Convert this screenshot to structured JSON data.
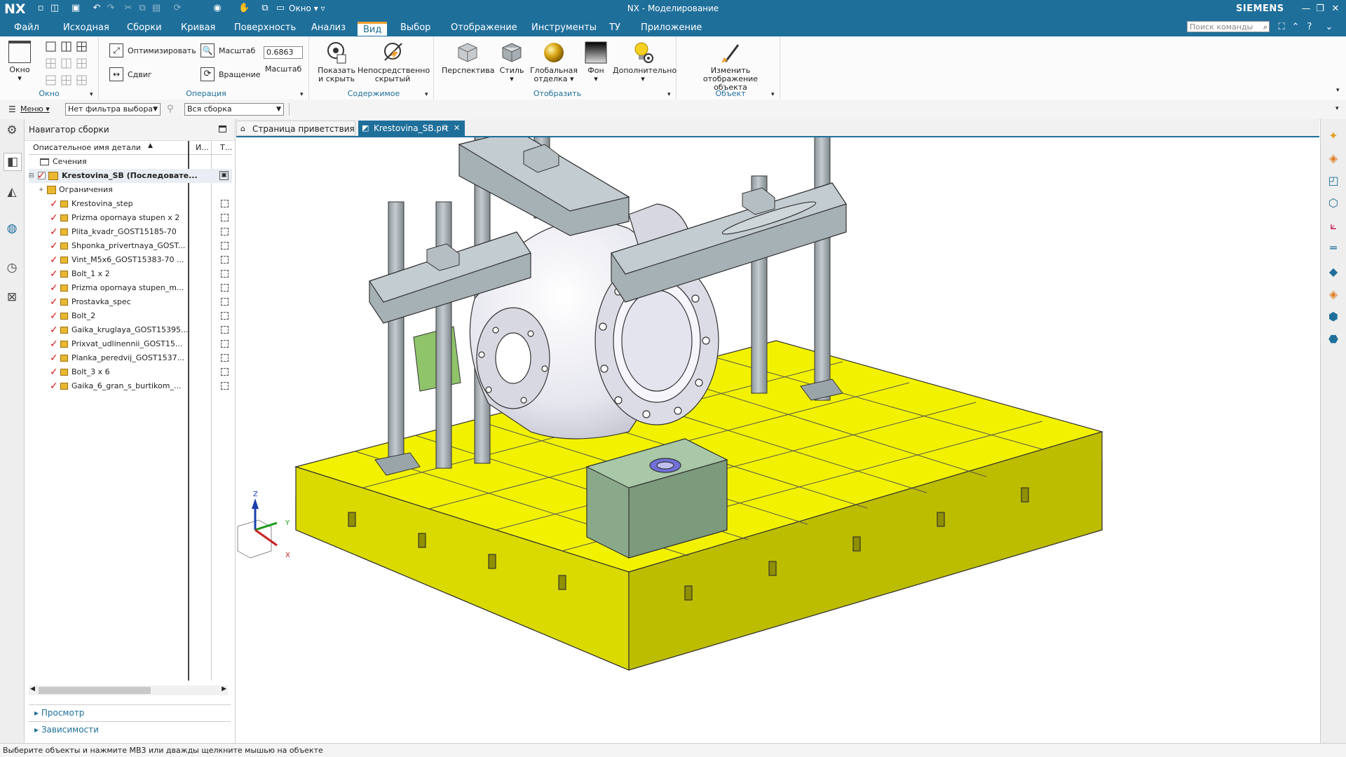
{
  "app": {
    "logo": "NX",
    "title": "NX - Моделирование",
    "brand": "SIEMENS",
    "window_menu_label": "Окно",
    "accent_color": "#1f6f9b",
    "highlight_color": "#f0a030"
  },
  "menubar": {
    "items": [
      "Файл",
      "Исходная",
      "Сборки",
      "Кривая",
      "Поверхность",
      "Анализ",
      "Вид",
      "Выбор",
      "Отображение",
      "Инструменты",
      "ТУ",
      "Приложение"
    ],
    "active_index": 6,
    "search_placeholder": "Поиск команды"
  },
  "ribbon": {
    "window_group": {
      "label": "Окно",
      "button": "Окно"
    },
    "operation_group": {
      "label": "Операция",
      "fit": "Оптимизировать",
      "pan": "Сдвиг",
      "zoom": "Масштаб",
      "rotate": "Вращение",
      "scale_value": "0.6863",
      "scale_label": "Масштаб"
    },
    "content_group": {
      "label": "Содержимое",
      "show_hide_line1": "Показать",
      "show_hide_line2": "и скрыть",
      "direct_hidden_line1": "Непосредственно",
      "direct_hidden_line2": "скрытый"
    },
    "display_group": {
      "label": "Отобразить",
      "perspective": "Перспектива",
      "style": "Стиль",
      "global_line1": "Глобальная",
      "global_line2": "отделка",
      "background": "Фон",
      "more": "Дополнительно"
    },
    "object_group": {
      "label": "Объект",
      "edit_line1": "Изменить",
      "edit_line2": "отображение объекта"
    }
  },
  "filterbar": {
    "menu_label": "Меню",
    "type_filter": "Нет фильтра выбора",
    "scope": "Вся сборка"
  },
  "navigator": {
    "title": "Навигатор сборки",
    "columns": {
      "name": "Описательное имя детали",
      "col2": "И...",
      "col3": "Т..."
    },
    "sections_node": "Сечения",
    "root": "Krestovina_SB (Последовате...",
    "constraints": "Ограничения",
    "parts": [
      "Krestovina_step",
      "Prizma opornaya stupen x 2",
      "Plita_kvadr_GOST15185-70",
      "Shponka_privertnaya_GOST...",
      "Vint_M5x6_GOST15383-70 ...",
      "Bolt_1 x 2",
      "Prizma opornaya stupen_m...",
      "Prostavka_spec",
      "Bolt_2",
      "Gaika_kruglaya_GOST15395...",
      "Prixvat_udlinennii_GOST15...",
      "Planka_peredvij_GOST1537...",
      "Bolt_3 x 6",
      "Gaika_6_gran_s_burtikom_..."
    ],
    "bottom_sections": [
      "Просмотр",
      "Зависимости"
    ]
  },
  "tabs": [
    {
      "label": "Страница приветствия",
      "active": false
    },
    {
      "label": "Krestovina_SB.prt",
      "active": true
    }
  ],
  "triad": {
    "z": "Z",
    "y": "Y",
    "x": "X"
  },
  "model_colors": {
    "table": "#f2f200",
    "table_shade": "#c9c900",
    "steel": "#a6b1b6",
    "steel_dark": "#7e8a90",
    "casting": "#e9e9f2",
    "prism": "#9cbd9c",
    "green_block": "#8fc46a"
  },
  "status": "Выберите объекты и нажмите MB3 или дважды щелкните мышью на объекте"
}
